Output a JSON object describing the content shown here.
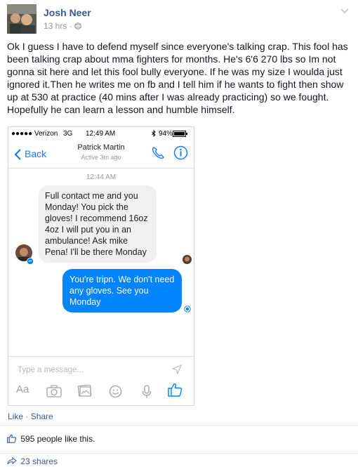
{
  "post": {
    "author": "Josh Neer",
    "time": "13 hrs",
    "time_sep": "·",
    "text": "Ok I guess I have to defend myself since everyone's talking crap. This fool has been talking crap about mma fighters for months. He's 6'6 270 lbs so Im not gonna sit here and let this fool bully everyone. If he was my size I woulda just ignored it.Then he writes me on fb and I tell him if he wants to fight then show up at 530 at practice (40 mins after I was already practicing) so we fought. Hopefully he can learn a lesson and humble himself."
  },
  "phone": {
    "status": {
      "carrier": "●●●●● Verizon",
      "network": "3G",
      "clock": "12:49 AM",
      "battery": "94%"
    },
    "nav": {
      "back_label": "Back",
      "contact_name": "Patrick Martin",
      "contact_status": "Active 3m ago"
    },
    "chat_time": "12:44 AM",
    "messages": [
      {
        "from": "other",
        "text": "Full contact me and you Monday! You pick the gloves! I recommend 16oz 4oz I will put you in an ambulance! Ask mike Pena! I'll be there Monday"
      },
      {
        "from": "me",
        "text": "You're tripn. We don't need any gloves. See you Monday"
      }
    ],
    "compose_placeholder": "Type a message..."
  },
  "actions": {
    "like": "Like",
    "dot": " · ",
    "share": "Share"
  },
  "likes_text": "595 people like this.",
  "shares_text": "23 shares",
  "colors": {
    "facebook_blue": "#3b5998",
    "messenger_blue": "#0084ff",
    "ios_blue": "#1c7cf4"
  }
}
